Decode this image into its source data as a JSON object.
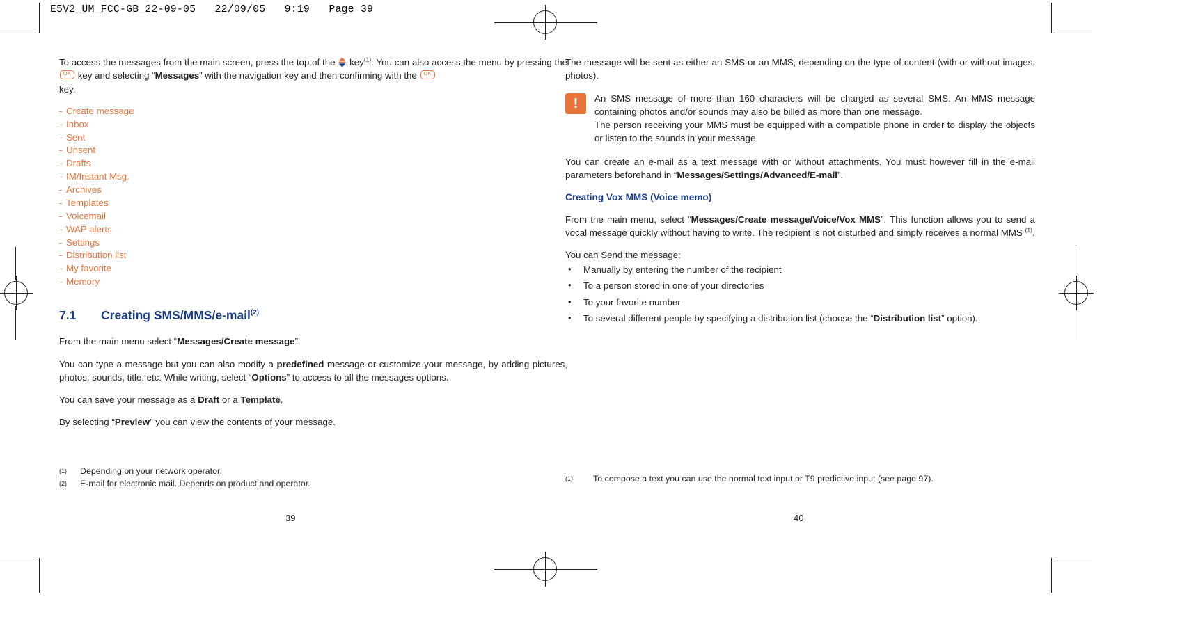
{
  "document": {
    "slug": "E5V2_UM_FCC-GB_22-09-05   22/09/05   9:19   Page 39"
  },
  "left_page": {
    "intro": {
      "part1": "To access the messages from the main screen, press the top of the",
      "key_nav_label": "navigation-key",
      "part2": "key",
      "footnote1": "(1)",
      "part3": ". You can also access the menu by pressing the",
      "key_ok_label": "OK",
      "part4": "key and selecting “",
      "messages_bold": "Messages",
      "part5": "” with the navigation key and then confirming with the",
      "part6": "key."
    },
    "menu_items": [
      "Create message",
      "Inbox",
      "Sent",
      "Unsent",
      "Drafts",
      "IM/Instant Msg.",
      "Archives",
      "Templates",
      "Voicemail",
      "WAP alerts",
      "Settings",
      "Distribution list",
      "My favorite",
      "Memory"
    ],
    "section": {
      "number": "7.1",
      "title": "Creating SMS/MMS/e-mail",
      "title_footnote": "(2)"
    },
    "para_from_menu": {
      "pre": "From the main menu select “",
      "bold": "Messages/Create message",
      "post": "”."
    },
    "para_type": {
      "p1": "You can type a message but you can also modify a ",
      "b1": "predefined",
      "p2": " message or customize your message, by adding pictures, photos, sounds, title, etc. While writing, select “",
      "b2": "Options",
      "p3": "” to access to all the messages options."
    },
    "para_save": {
      "p1": "You can save your message as a ",
      "b1": "Draft",
      "p2": " or a ",
      "b2": "Template",
      "p3": "."
    },
    "para_preview": {
      "p1": "By selecting “",
      "b1": "Preview",
      "p2": "” you can view the contents of your message."
    },
    "footnotes": [
      {
        "mark": "(1)",
        "text": "Depending on your network operator."
      },
      {
        "mark": "(2)",
        "text": "E-mail for electronic mail. Depends on product and operator."
      }
    ],
    "folio": "39"
  },
  "right_page": {
    "para_sms_mms": "The message will be sent as either an SMS or an MMS, depending on the type of content (with or without images, photos).",
    "note": {
      "icon_label": "!",
      "line1": "An SMS message of more than 160 characters will be charged as several SMS. An MMS message containing photos and/or sounds may also be billed as more than one message.",
      "line2": "The person receiving your MMS must be equipped with a compatible phone in order to display the objects or listen to the sounds in your message."
    },
    "para_email": {
      "p1": "You can create an e-mail as a text message with or without attachments. You must however fill in the e-mail parameters beforehand in “",
      "b1": "Messages/Settings/Advanced/E-mail",
      "p2": "”."
    },
    "sub_head": "Creating Vox MMS (Voice memo)",
    "para_vox": {
      "p1": "From the main menu, select “",
      "b1": "Messages/Create message/Voice/Vox MMS",
      "p2": "”. This function allows you to send a vocal message quickly without having to write. The recipient is not disturbed and simply receives a normal MMS ",
      "fn": "(1)",
      "p3": "."
    },
    "send_intro": "You can Send the message:",
    "send_options": [
      {
        "p1": "Manually by entering the number of the recipient",
        "b1": "",
        "p2": ""
      },
      {
        "p1": "To a person stored in one of your directories",
        "b1": "",
        "p2": ""
      },
      {
        "p1": "To your favorite number",
        "b1": "",
        "p2": ""
      },
      {
        "p1": "To several different people by specifying a distribution list (choose the “",
        "b1": "Distribution list",
        "p2": "” option)."
      }
    ],
    "footnotes": [
      {
        "mark": "(1)",
        "text": "To compose a text you can use the normal text input or T9 predictive input (see page 97)."
      }
    ],
    "folio": "40"
  },
  "colors": {
    "orange": "#e8743b",
    "blue": "#1b3f8b",
    "text": "#231f20"
  }
}
